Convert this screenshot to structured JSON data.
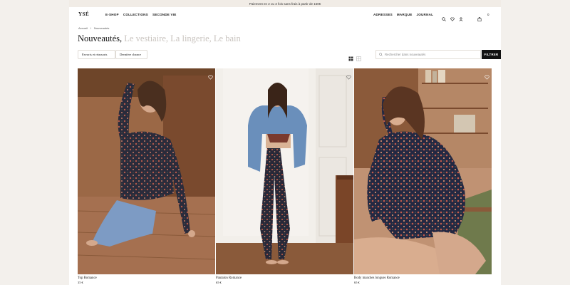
{
  "announcement": "Paiement en 2 ou 3 fois sans frais à partir de 150€",
  "brand": "YSÉ",
  "nav": {
    "left": [
      "E-SHOP",
      "COLLECTIONS",
      "SECONDE VIE"
    ],
    "right": [
      "ADRESSES",
      "MARQUE",
      "JOURNAL"
    ],
    "icons": [
      "search-icon",
      "heart-icon",
      "user-icon",
      "bag-icon"
    ],
    "cart_count": "0"
  },
  "breadcrumb": [
    "Accueil",
    "Nouveautés"
  ],
  "page": {
    "title_active": "Nouveautés",
    "title_sep": ",",
    "title_others": "Le vestiaire, La lingerie, Le bain"
  },
  "filters": {
    "chips": [
      "Favoris et réassorts",
      "Dernière chance"
    ],
    "search_placeholder": "Rechercher dans nouveautés",
    "filter_label": "FILTRER",
    "view_toggles": [
      "grid-large-icon",
      "grid-small-icon"
    ]
  },
  "products": [
    {
      "name": "Top Romance",
      "price": "35 €"
    },
    {
      "name": "Pantalon Romance",
      "price": "65 €"
    },
    {
      "name": "Body manches longues Romance",
      "price": "65 €"
    }
  ],
  "colors": {
    "background": "#f3f0ec",
    "accent": "#111111",
    "muted": "#c9c4bf"
  }
}
